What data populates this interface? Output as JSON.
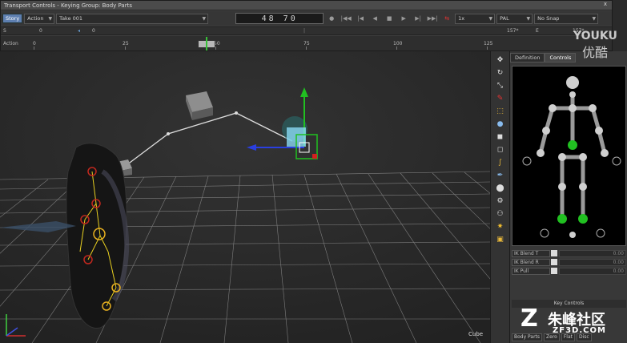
{
  "window": {
    "title": "Transport Controls - Keying Group: Body Parts",
    "close_glyph": "x"
  },
  "transport": {
    "story_button": "Story",
    "mode_dropdown": "Action",
    "take_dropdown": "Take 001",
    "timecode": "48 70",
    "snap_rate": "1x",
    "format_dropdown": "PAL",
    "snap_dropdown": "No Snap",
    "row2": {
      "s_label": "S",
      "start_value": "0",
      "cursor_value": "0",
      "end_value": "157*",
      "e_label": "E",
      "end_value_right": "157*"
    },
    "timeline": {
      "action_label": "Action",
      "ticks": [
        "0",
        "25",
        "50",
        "75",
        "100",
        "125"
      ]
    }
  },
  "viewport": {
    "object_label": "Cube"
  },
  "toolstrip": {
    "icons": [
      "move-icon",
      "rotate-icon",
      "scale-icon",
      "paint-icon",
      "frame-icon",
      "sphere-icon",
      "cube-icon",
      "cube-outline-icon",
      "curve-icon",
      "pen-icon",
      "dot-icon",
      "gear-icon",
      "joint-icon",
      "star-icon",
      "box-select-icon"
    ]
  },
  "rightpanel": {
    "tab_definition": "Definition",
    "tab_controls": "Controls",
    "ik_rows": [
      {
        "label": "IK Blend T",
        "value": "0.00"
      },
      {
        "label": "IK Blend R",
        "value": "0.00"
      },
      {
        "label": "IK Pull",
        "value": "0.00"
      }
    ],
    "key_controls_label": "Key Controls",
    "bottom_dropdown": "Body Parts",
    "bottom_zero": "Zero",
    "bottom_flat": "Flat",
    "bottom_disc": "Disc"
  },
  "watermarks": {
    "youku_line1": "YOUKU",
    "youku_line2": "优酷",
    "zf_logo": "Z",
    "zf_cn": "朱峰社区",
    "zf_url": "ZF3D.COM"
  },
  "colors": {
    "playhead_green": "#38c038",
    "effector_green": "#21c021",
    "story_blue": "#5e7fb0"
  }
}
